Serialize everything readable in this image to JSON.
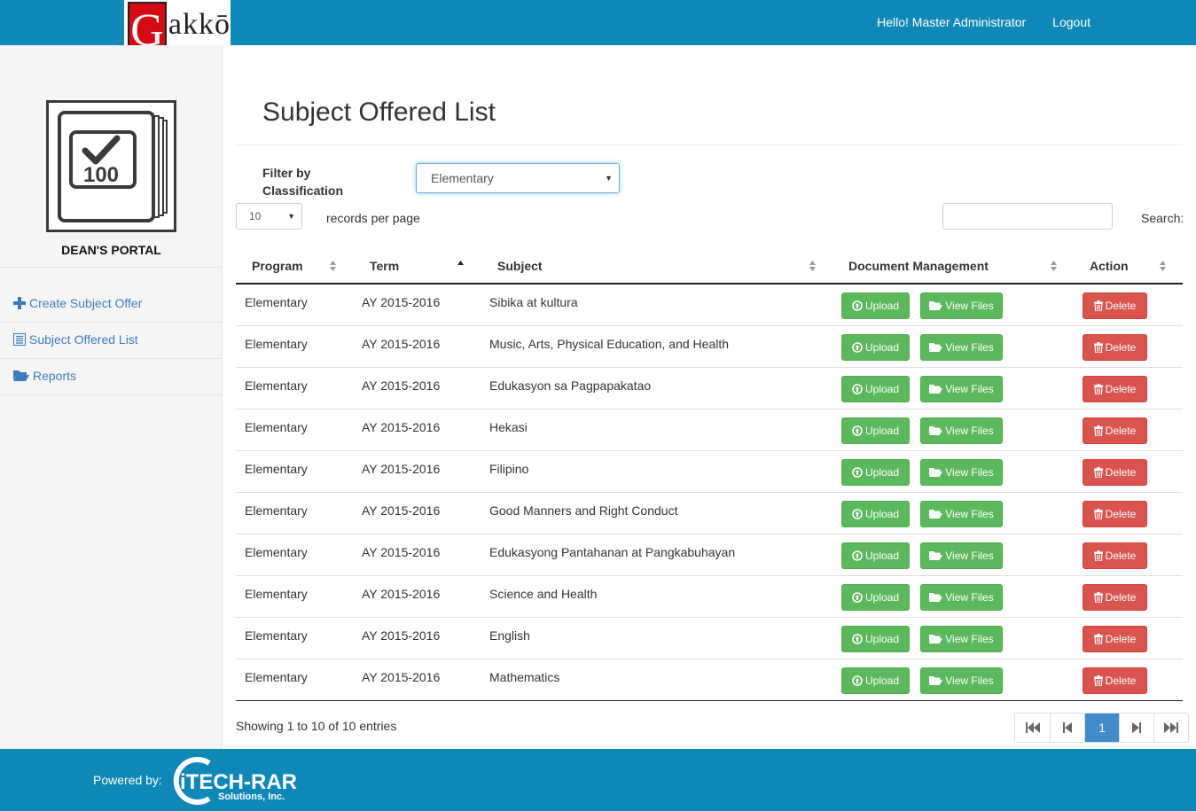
{
  "header": {
    "logo_letter": "G",
    "logo_rest": "akkō",
    "greeting": "Hello! Master Administrator",
    "logout": "Logout"
  },
  "sidebar": {
    "portal_badge": "100",
    "portal_title": "DEAN'S PORTAL",
    "items": [
      {
        "label": "Create Subject Offer",
        "icon": "plus-icon"
      },
      {
        "label": "Subject Offered List",
        "icon": "list-icon"
      },
      {
        "label": "Reports",
        "icon": "folder-open-icon"
      }
    ]
  },
  "main": {
    "title": "Subject Offered List",
    "filter_label_1": "Filter by",
    "filter_label_2": "Classification",
    "filter_value": "Elementary",
    "page_length": "10",
    "page_length_label": "records per page",
    "search_label": "Search:",
    "search_value": ""
  },
  "table": {
    "columns": [
      "Program",
      "Term",
      "Subject",
      "Document Management",
      "Action"
    ],
    "sorted_column": "Term",
    "buttons": {
      "upload": "Upload",
      "view": "View Files",
      "delete": "Delete"
    },
    "rows": [
      {
        "program": "Elementary",
        "term": "AY 2015-2016",
        "subject": "Sibika at kultura"
      },
      {
        "program": "Elementary",
        "term": "AY 2015-2016",
        "subject": "Music, Arts, Physical Education, and Health"
      },
      {
        "program": "Elementary",
        "term": "AY 2015-2016",
        "subject": "Edukasyon sa Pagpapakatao"
      },
      {
        "program": "Elementary",
        "term": "AY 2015-2016",
        "subject": "Hekasi"
      },
      {
        "program": "Elementary",
        "term": "AY 2015-2016",
        "subject": "Filipino"
      },
      {
        "program": "Elementary",
        "term": "AY 2015-2016",
        "subject": "Good Manners and Right Conduct"
      },
      {
        "program": "Elementary",
        "term": "AY 2015-2016",
        "subject": "Edukasyong Pantahanan at Pangkabuhayan"
      },
      {
        "program": "Elementary",
        "term": "AY 2015-2016",
        "subject": "Science and Health"
      },
      {
        "program": "Elementary",
        "term": "AY 2015-2016",
        "subject": "English"
      },
      {
        "program": "Elementary",
        "term": "AY 2015-2016",
        "subject": "Mathematics"
      }
    ],
    "info": "Showing 1 to 10 of 10 entries",
    "current_page": "1"
  },
  "footer": {
    "powered_by": "Powered by:",
    "company": "iTECH-RAR",
    "company_sub": "Solutions, Inc."
  },
  "colors": {
    "brand_bar": "#0f88b8",
    "link": "#3c7cbd",
    "success": "#5cb85c",
    "danger": "#d9534f",
    "page_active": "#428bca"
  }
}
